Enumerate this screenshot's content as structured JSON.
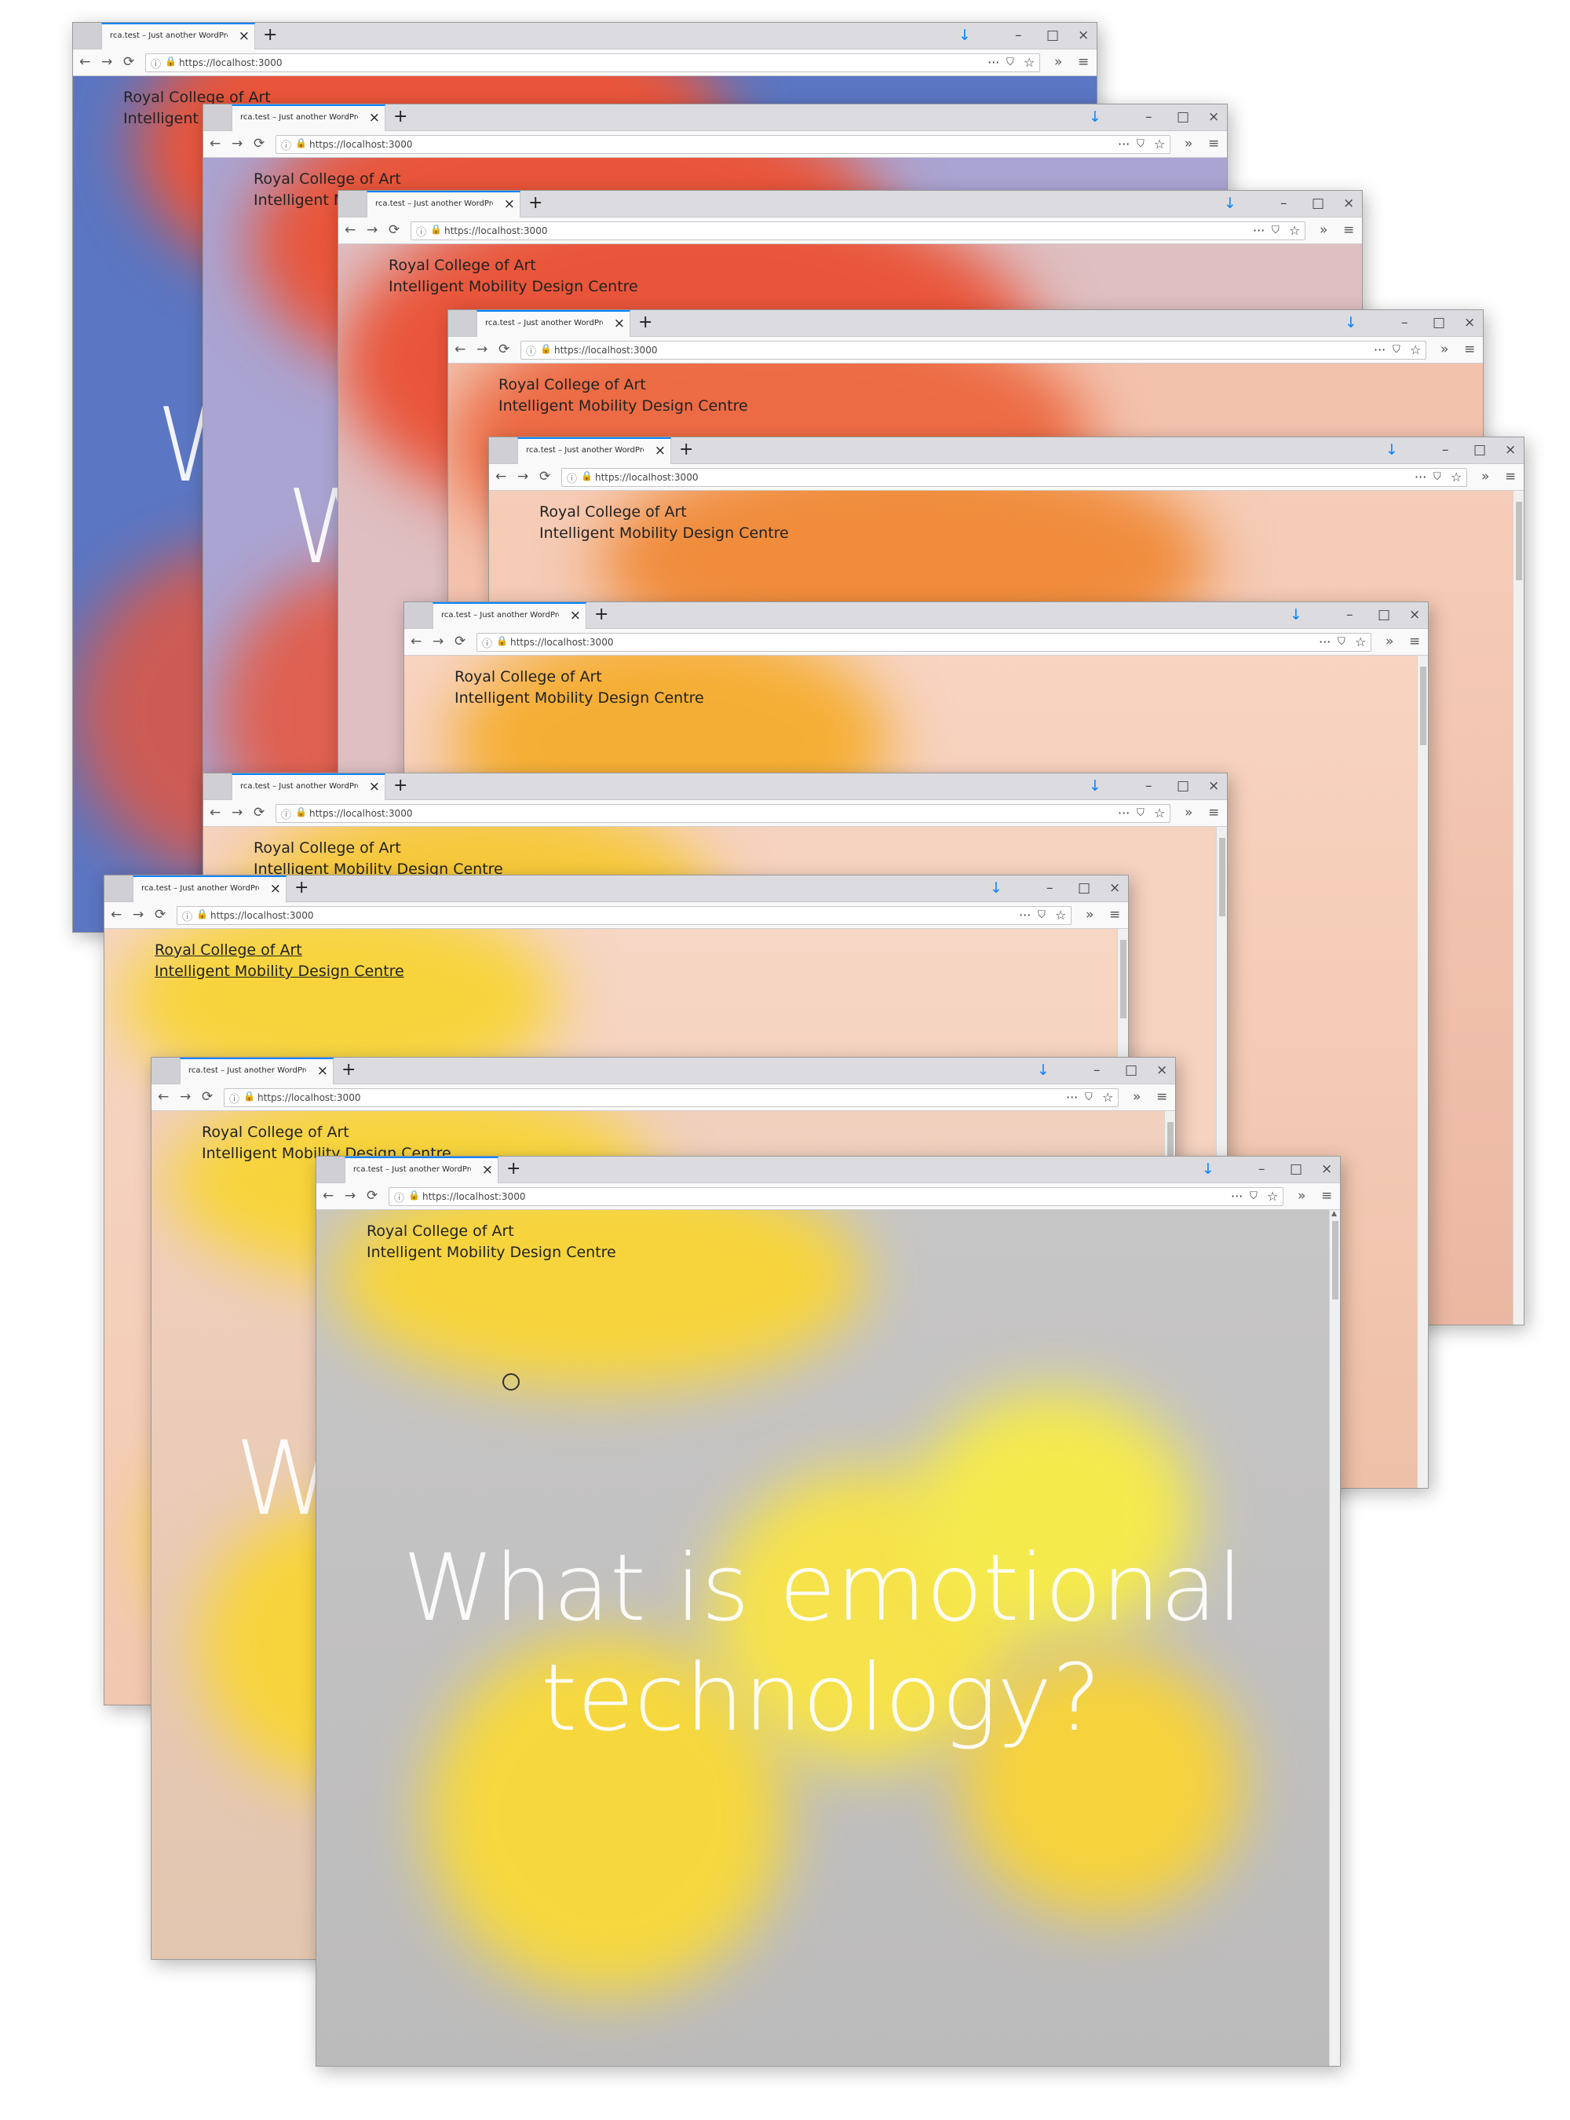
{
  "browser": {
    "tab_title": "rca.test – Just another WordPress si",
    "tab_close": "×",
    "new_tab": "+",
    "download": "↓",
    "minimize": "–",
    "maximize": "□",
    "close": "×",
    "back": "←",
    "forward": "→",
    "reload": "⟳",
    "info": "ⓘ",
    "lock": "🔒",
    "url": "https://localhost:3000",
    "page_actions": "···",
    "pocket": "⛉",
    "bookmark": "☆",
    "overflow": "»",
    "menu": "≡"
  },
  "site": {
    "line1": "Royal College of Art",
    "line2": "Intelligent Mobility Design Centre",
    "hero_line1": "What is emotional",
    "hero_line2": "technology?",
    "partial_hero_w": "W",
    "partial_hero_nal": "nal"
  },
  "colors": {
    "blue": "#5b76c2",
    "red_orange": "#e9553a",
    "lavender": "#aaa4d2",
    "pink": "#dfbfc2",
    "salmon": "#f3c2ad",
    "orange": "#f08c3c",
    "peach": "#f6d2c0",
    "amber": "#f5ae35",
    "yellow": "#f6d23c",
    "grey": "#c4c3c3",
    "bright_yellow": "#f5ea4c"
  }
}
